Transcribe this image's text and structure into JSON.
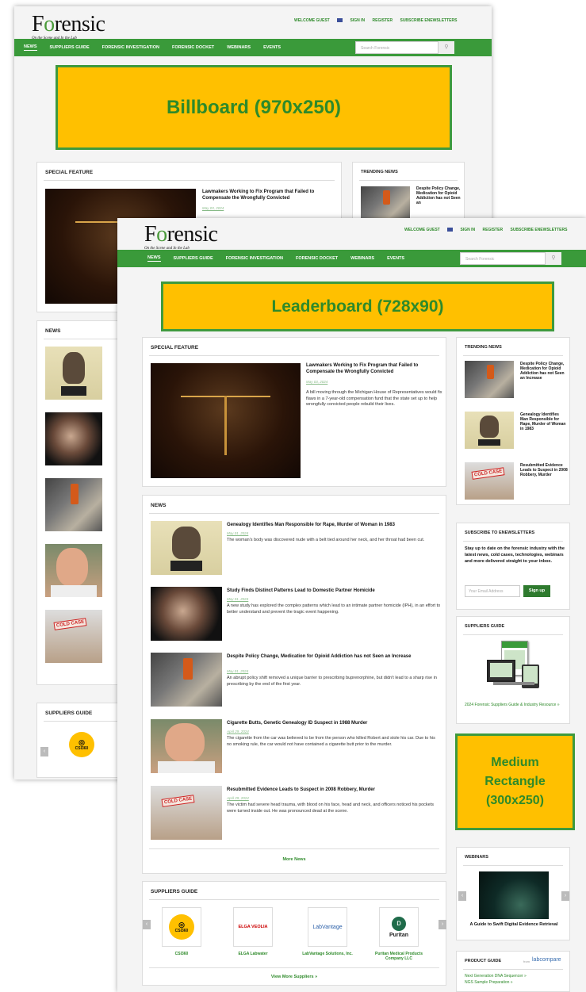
{
  "brand": {
    "logo_pre": "F",
    "logo_o": "o",
    "logo_post": "rensic",
    "tagline": "On the Scene and In the Lab"
  },
  "toplinks": {
    "welcome": "WELCOME GUEST",
    "signin": "SIGN IN",
    "register": "REGISTER",
    "subscribe": "SUBSCRIBE ENEWSLETTERS"
  },
  "nav": [
    "NEWS",
    "SUPPLIERS GUIDE",
    "FORENSIC INVESTIGATION",
    "FORENSIC DOCKET",
    "WEBINARS",
    "EVENTS"
  ],
  "search_placeholder": "Search Forensic",
  "ads": {
    "billboard": "Billboard (970x250)",
    "leaderboard": "Leaderboard (728x90)",
    "medium_rect": "Medium Rectangle (300x250)"
  },
  "special_feature": {
    "heading": "SPECIAL FEATURE",
    "title": "Lawmakers Working to Fix Program that Failed to Compensate the Wrongfully Convicted",
    "date": "May 03, 2024",
    "summary": "A bill moving through the Michigan House of Representatives would fix flaws in a 7-year-old compensation fund that the state set up to help wrongfully convicted people rebuild their lives."
  },
  "news": {
    "heading": "NEWS",
    "items": [
      {
        "title": "Genealogy Identifies Man Responsible for Rape, Murder of Woman in 1983",
        "date": "May 01, 2024",
        "summary": "The woman's body was discovered nude with a belt tied around her neck, and her throat had been cut."
      },
      {
        "title": "Study Finds Distinct Patterns Lead to Domestic Partner Homicide",
        "date": "May 01, 2024",
        "summary": "A new study has explored the complex patterns which lead to an intimate partner homicide (IPH), in an effort to better understand and prevent the tragic event happening."
      },
      {
        "title": "Despite Policy Change, Medication for Opioid Addiction has not Seen an Increase",
        "date": "May 01, 2024",
        "summary": "An abrupt policy shift removed a unique barrier to prescribing buprenorphine, but didn't lead to a sharp rise in prescribing by the end of the first year."
      },
      {
        "title": "Cigarette Butts, Genetic Genealogy ID Suspect in 1988 Murder",
        "date": "April 29, 2024",
        "summary": "The cigarette from the car was believed to be from the person who killed Robert and stole his car. Due to his no smoking rule, the car would not have contained a cigarette butt prior to the murder."
      },
      {
        "title": "Resubmitted Evidence Leads to Suspect in 2008 Robbery, Murder",
        "date": "April 29, 2024",
        "summary": "The victim had severe head trauma, with blood on his face, head and neck, and officers noticed his pockets were turned inside out. He was pronounced dead at the scene."
      }
    ],
    "more": "More News"
  },
  "trending": {
    "heading": "TRENDING NEWS",
    "items": [
      "Despite Policy Change, Medication for Opioid Addiction has not Seen an Increase",
      "Genealogy Identifies Man Responsible for Rape, Murder of Woman in 1983",
      "Resubmitted Evidence Leads to Suspect in 2008 Robbery, Murder"
    ],
    "back_title": "Despite Policy Change, Medication for Opioid Addiction has not Seen an"
  },
  "subscribe": {
    "heading": "SUBSCRIBE TO ENEWSLETTERS",
    "text": "Stay up to date on the forensic industry with the latest news, cold cases, technologies, webinars and more delivered straight to your inbox.",
    "placeholder": "Your Email Address",
    "button": "Sign up"
  },
  "suppliers_side": {
    "heading": "SUPPLIERS GUIDE",
    "caption": "2024 Forensic Suppliers Guide & Industry Resource »"
  },
  "webinars": {
    "heading": "WEBINARS",
    "caption": "A Guide to Swift Digital Evidence Retrieval"
  },
  "product_guide": {
    "heading": "PRODUCT GUIDE",
    "from": "from",
    "brand": "labcompare",
    "items": [
      "Next Generation DNA Sequencer »",
      "NGS Sample Preparation »"
    ]
  },
  "suppliers": {
    "heading": "SUPPLIERS GUIDE",
    "items": [
      {
        "name": "CSI360",
        "logo": "CSI360"
      },
      {
        "name": "ELGA Labwater",
        "logo": "ELGA VEOLIA"
      },
      {
        "name": "LabVantage Solutions, Inc.",
        "logo": "LabVantage"
      },
      {
        "name": "Puritan Medical Products Company LLC",
        "logo": "Puritan"
      }
    ],
    "view_more": "View More Suppliers »"
  },
  "colors": {
    "green": "#3a9a3a",
    "ad_fill": "#ffc000"
  }
}
